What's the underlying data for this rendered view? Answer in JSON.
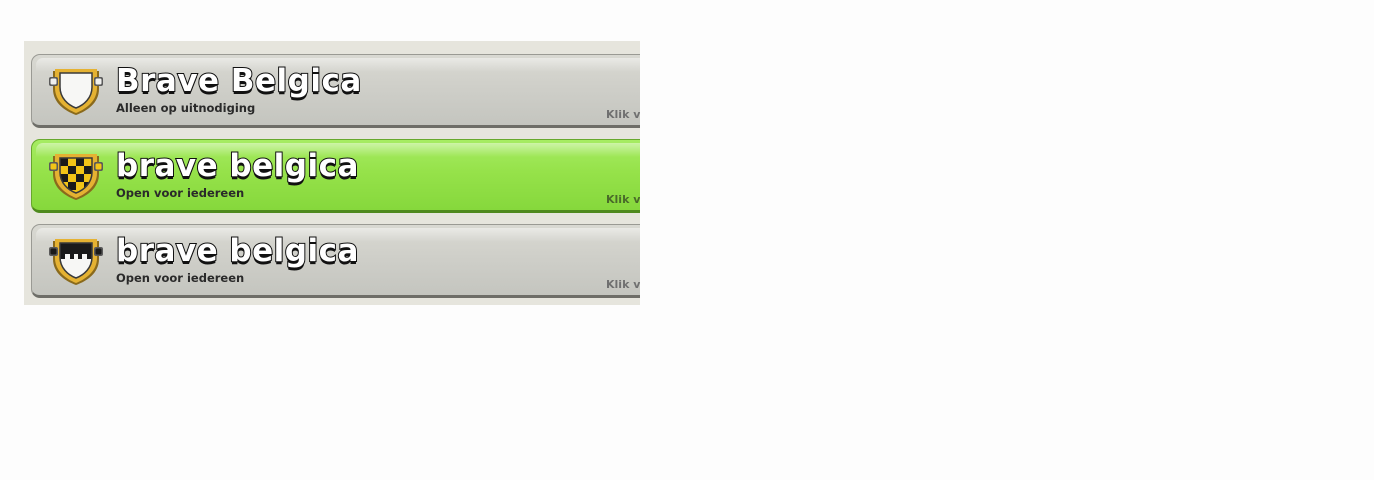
{
  "clan_list": {
    "items": [
      {
        "name": "Brave Belgica",
        "status": "Alleen op uitnodiging",
        "hint": "Klik v",
        "highlighted": false,
        "badge_icon": "white-shield-badge-icon",
        "colors": {
          "background": "#cfcfc9",
          "badge_fill": "#ffffff",
          "badge_trim": "#d9a72a"
        }
      },
      {
        "name": "brave belgica",
        "status": "Open voor iedereen",
        "hint": "Klik v",
        "highlighted": true,
        "badge_icon": "checkered-shield-badge-icon",
        "colors": {
          "background": "#96e24a",
          "badge_fill": "#f2c417",
          "badge_checks": "#1a1a1a",
          "badge_trim": "#d9a72a"
        }
      },
      {
        "name": "brave belgica",
        "status": "Open voor iedereen",
        "hint": "Klik v",
        "highlighted": false,
        "badge_icon": "castle-shield-badge-icon",
        "colors": {
          "background": "#cfcfc9",
          "badge_fill": "#ffffff",
          "badge_dark": "#1a1a1a",
          "badge_trim": "#d9a72a"
        }
      }
    ]
  }
}
